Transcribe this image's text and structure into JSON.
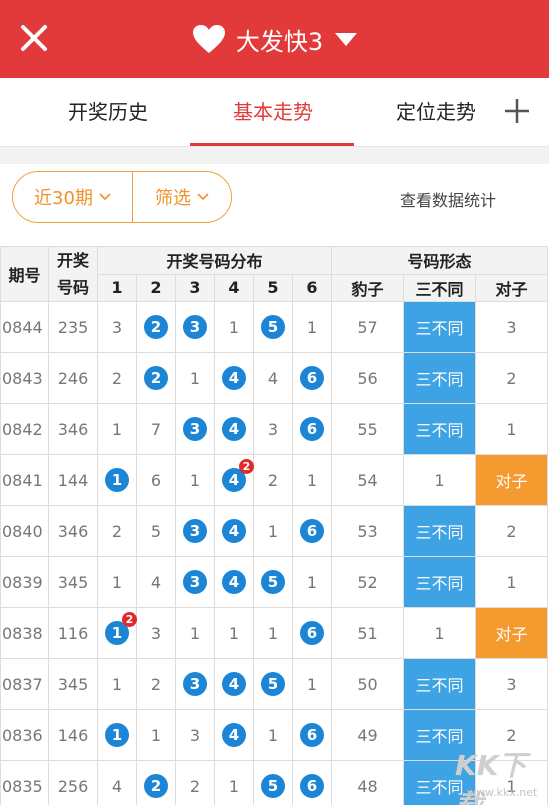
{
  "header": {
    "title": "大发快3",
    "close_icon": "close-icon",
    "heart_icon": "heart-icon",
    "dropdown_icon": "caret-down-icon"
  },
  "tabs": [
    {
      "label": "开奖历史",
      "active": false
    },
    {
      "label": "基本走势",
      "active": true
    },
    {
      "label": "定位走势",
      "active": false
    }
  ],
  "add_tab_icon": "plus-icon",
  "filter": {
    "period_label": "近30期",
    "filter_label": "筛选",
    "stats_link": "查看数据统计"
  },
  "colors": {
    "header": "#e23a3a",
    "ball": "#1d85d6",
    "sanbutong": "#3ea3e4",
    "duizi": "#f59a2f",
    "accent_orange": "#f0912a"
  },
  "table": {
    "h_issue": "期号",
    "h_number": "开奖号码",
    "h_distribution": "开奖号码分布",
    "h_pattern": "号码形态",
    "digits": [
      "1",
      "2",
      "3",
      "4",
      "5",
      "6"
    ],
    "patterns": [
      "豹子",
      "三不同",
      "对子"
    ],
    "rows": [
      {
        "issue": "0844",
        "num": "235",
        "d": [
          "3",
          "2",
          "3",
          "1",
          "5",
          "1"
        ],
        "hit": [
          false,
          true,
          true,
          false,
          true,
          false
        ],
        "rep": [
          null,
          null,
          null,
          null,
          null,
          null
        ],
        "baozi": "57",
        "sbt": "三不同",
        "sbt_hit": true,
        "dz": "3",
        "dz_hit": false
      },
      {
        "issue": "0843",
        "num": "246",
        "d": [
          "2",
          "2",
          "1",
          "4",
          "4",
          "6"
        ],
        "hit": [
          false,
          true,
          false,
          true,
          false,
          true
        ],
        "rep": [
          null,
          null,
          null,
          null,
          null,
          null
        ],
        "baozi": "56",
        "sbt": "三不同",
        "sbt_hit": true,
        "dz": "2",
        "dz_hit": false
      },
      {
        "issue": "0842",
        "num": "346",
        "d": [
          "1",
          "7",
          "3",
          "4",
          "3",
          "6"
        ],
        "hit": [
          false,
          false,
          true,
          true,
          false,
          true
        ],
        "rep": [
          null,
          null,
          null,
          null,
          null,
          null
        ],
        "baozi": "55",
        "sbt": "三不同",
        "sbt_hit": true,
        "dz": "1",
        "dz_hit": false
      },
      {
        "issue": "0841",
        "num": "144",
        "d": [
          "1",
          "6",
          "1",
          "4",
          "2",
          "1"
        ],
        "hit": [
          true,
          false,
          false,
          true,
          false,
          false
        ],
        "rep": [
          null,
          null,
          null,
          "2",
          null,
          null
        ],
        "baozi": "54",
        "sbt": "1",
        "sbt_hit": false,
        "dz": "对子",
        "dz_hit": true
      },
      {
        "issue": "0840",
        "num": "346",
        "d": [
          "2",
          "5",
          "3",
          "4",
          "1",
          "6"
        ],
        "hit": [
          false,
          false,
          true,
          true,
          false,
          true
        ],
        "rep": [
          null,
          null,
          null,
          null,
          null,
          null
        ],
        "baozi": "53",
        "sbt": "三不同",
        "sbt_hit": true,
        "dz": "2",
        "dz_hit": false
      },
      {
        "issue": "0839",
        "num": "345",
        "d": [
          "1",
          "4",
          "3",
          "4",
          "5",
          "1"
        ],
        "hit": [
          false,
          false,
          true,
          true,
          true,
          false
        ],
        "rep": [
          null,
          null,
          null,
          null,
          null,
          null
        ],
        "baozi": "52",
        "sbt": "三不同",
        "sbt_hit": true,
        "dz": "1",
        "dz_hit": false
      },
      {
        "issue": "0838",
        "num": "116",
        "d": [
          "1",
          "3",
          "1",
          "1",
          "1",
          "6"
        ],
        "hit": [
          true,
          false,
          false,
          false,
          false,
          true
        ],
        "rep": [
          "2",
          null,
          null,
          null,
          null,
          null
        ],
        "baozi": "51",
        "sbt": "1",
        "sbt_hit": false,
        "dz": "对子",
        "dz_hit": true
      },
      {
        "issue": "0837",
        "num": "345",
        "d": [
          "1",
          "2",
          "3",
          "4",
          "5",
          "1"
        ],
        "hit": [
          false,
          false,
          true,
          true,
          true,
          false
        ],
        "rep": [
          null,
          null,
          null,
          null,
          null,
          null
        ],
        "baozi": "50",
        "sbt": "三不同",
        "sbt_hit": true,
        "dz": "3",
        "dz_hit": false
      },
      {
        "issue": "0836",
        "num": "146",
        "d": [
          "1",
          "1",
          "3",
          "4",
          "1",
          "6"
        ],
        "hit": [
          true,
          false,
          false,
          true,
          false,
          true
        ],
        "rep": [
          null,
          null,
          null,
          null,
          null,
          null
        ],
        "baozi": "49",
        "sbt": "三不同",
        "sbt_hit": true,
        "dz": "2",
        "dz_hit": false
      },
      {
        "issue": "0835",
        "num": "256",
        "d": [
          "4",
          "2",
          "2",
          "1",
          "5",
          "6"
        ],
        "hit": [
          false,
          true,
          false,
          false,
          true,
          true
        ],
        "rep": [
          null,
          null,
          null,
          null,
          null,
          null
        ],
        "baozi": "48",
        "sbt": "三不同",
        "sbt_hit": true,
        "dz": "1",
        "dz_hit": false
      }
    ]
  },
  "watermark": {
    "main": "KK下载",
    "sub": "www.kkx.net"
  }
}
